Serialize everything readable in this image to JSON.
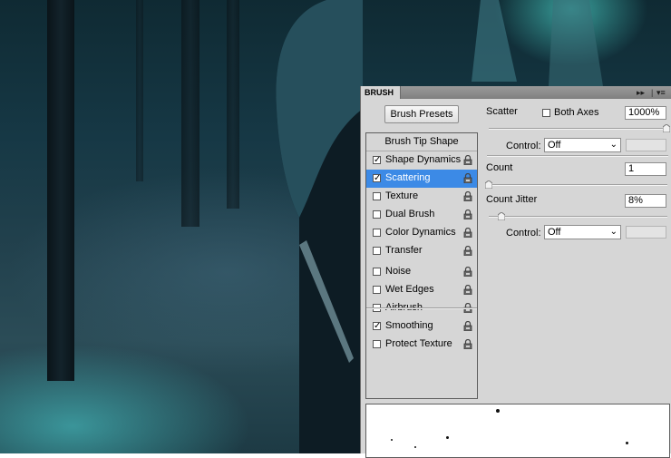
{
  "panel": {
    "tab_title": "BRUSH",
    "menu_icon": "panel-menu-icon",
    "collapse_icon": "double-arrow-icon"
  },
  "presets_button": "Brush Presets",
  "tip_header": "Brush Tip Shape",
  "items": [
    {
      "label": "Shape Dynamics",
      "checked": true,
      "selected": false
    },
    {
      "label": "Scattering",
      "checked": true,
      "selected": true
    },
    {
      "label": "Texture",
      "checked": false,
      "selected": false
    },
    {
      "label": "Dual Brush",
      "checked": false,
      "selected": false
    },
    {
      "label": "Color Dynamics",
      "checked": false,
      "selected": false
    },
    {
      "label": "Transfer",
      "checked": false,
      "selected": false
    },
    {
      "label": "Noise",
      "checked": false,
      "selected": false
    },
    {
      "label": "Wet Edges",
      "checked": false,
      "selected": false
    },
    {
      "label": "Airbrush",
      "checked": false,
      "selected": false
    },
    {
      "label": "Smoothing",
      "checked": true,
      "selected": false
    },
    {
      "label": "Protect Texture",
      "checked": false,
      "selected": false
    }
  ],
  "scatter": {
    "label": "Scatter",
    "both_axes_label": "Both Axes",
    "both_axes_checked": false,
    "value": "1000%",
    "control_label": "Control:",
    "control_value": "Off"
  },
  "count": {
    "label": "Count",
    "value": "1"
  },
  "count_jitter": {
    "label": "Count Jitter",
    "value": "8%",
    "control_label": "Control:",
    "control_value": "Off"
  },
  "colors": {
    "selection": "#3c8ae6",
    "panel_bg": "#d6d6d6"
  }
}
